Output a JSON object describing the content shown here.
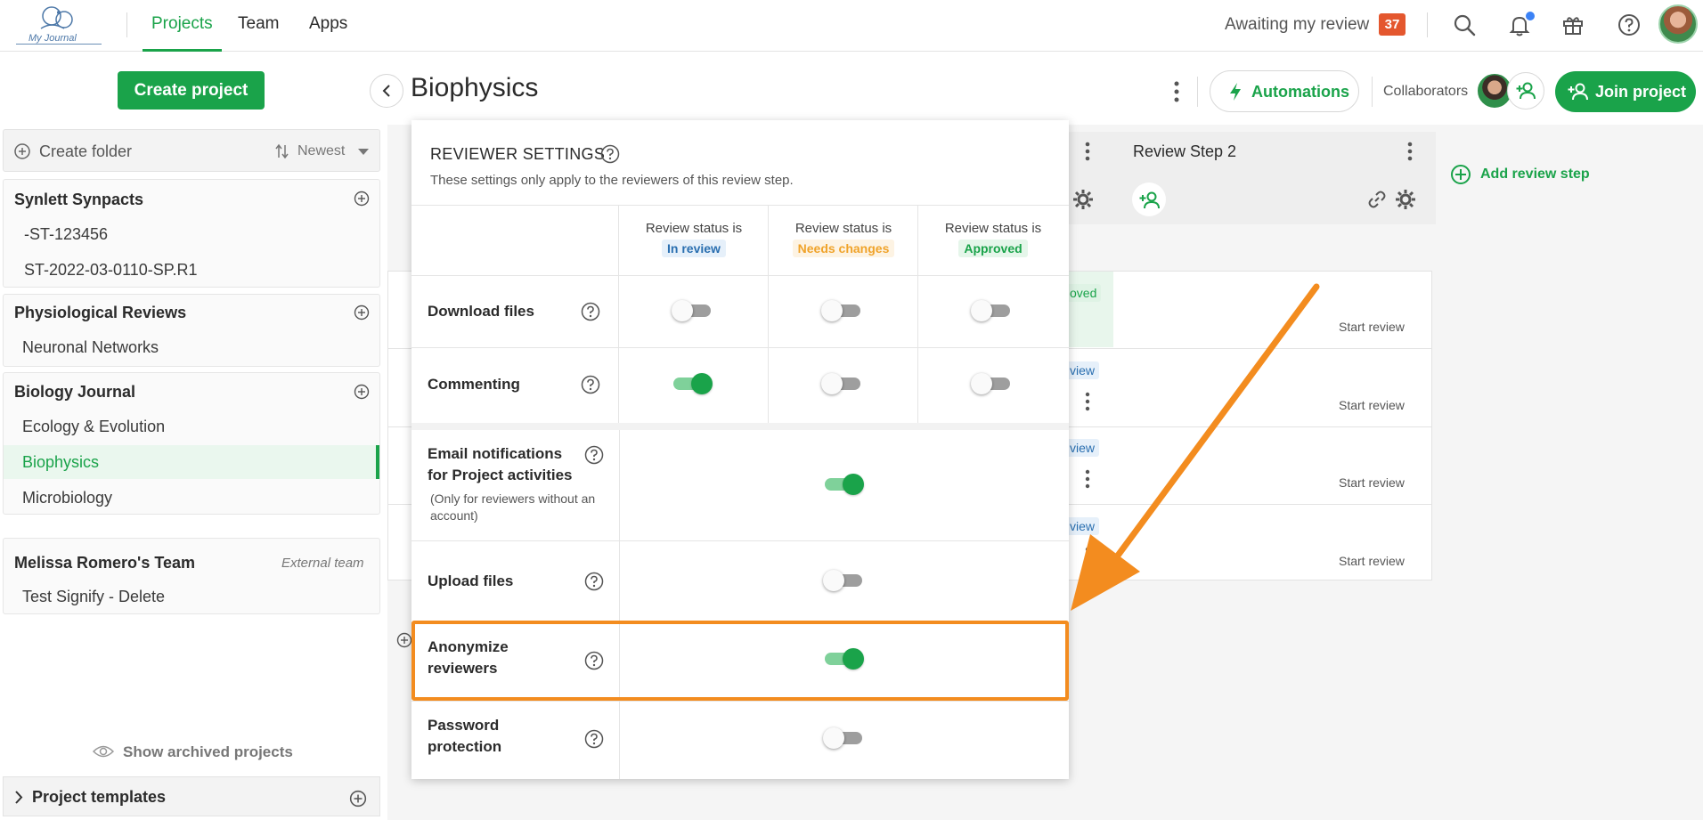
{
  "topbar": {
    "logo_text": "My Journal",
    "nav": [
      {
        "label": "Projects",
        "active": true
      },
      {
        "label": "Team",
        "active": false
      },
      {
        "label": "Apps",
        "active": false
      }
    ],
    "awaiting_label": "Awaiting my review",
    "awaiting_count": "37",
    "icons": [
      "search-icon",
      "bell-icon",
      "gift-icon",
      "help-icon"
    ]
  },
  "sidebar": {
    "create_project": "Create project",
    "create_folder": "Create folder",
    "sort": "Newest",
    "groups": [
      {
        "title": "Synlett Synpacts",
        "items": [
          "-ST-123456",
          "ST-2022-03-0110-SP.R1"
        ]
      },
      {
        "title": "Physiological Reviews",
        "items": [
          "Neuronal Networks"
        ]
      },
      {
        "title": "Biology Journal",
        "items": [
          "Ecology & Evolution",
          "Biophysics",
          "Microbiology"
        ],
        "active_item": "Biophysics"
      },
      {
        "title": "Melissa Romero's Team",
        "tag": "External team",
        "items": [
          "Test Signify - Delete"
        ]
      }
    ],
    "show_archived": "Show archived projects",
    "project_templates": "Project templates"
  },
  "main": {
    "title": "Biophysics",
    "automations": "Automations",
    "collaborators": "Collaborators",
    "join_project": "Join project",
    "review_step_2": "Review Step 2",
    "add_review_step": "Add review step",
    "rows": [
      {
        "status": "oved",
        "action": "Start review"
      },
      {
        "status": "view",
        "action": "Start review"
      },
      {
        "status": "view",
        "action": "Start review"
      },
      {
        "status": "view",
        "action": "Start review"
      }
    ]
  },
  "popup": {
    "title": "REVIEWER SETTINGS",
    "subtitle": "These settings only apply to the reviewers of this review step.",
    "column_prefix": "Review status is",
    "columns": [
      {
        "status": "In review",
        "color": "#2a6fb0",
        "bg": "#e6f0fa"
      },
      {
        "status": "Needs changes",
        "color": "#f0a32a",
        "bg": "#fdf3e3"
      },
      {
        "status": "Approved",
        "color": "#1aa34a",
        "bg": "#e5f6ea"
      }
    ],
    "per_status_rows": [
      {
        "label": "Download files",
        "values": [
          false,
          false,
          false
        ]
      },
      {
        "label": "Commenting",
        "values": [
          true,
          false,
          false
        ]
      }
    ],
    "global_rows": [
      {
        "label": "Email notifications for Project activities",
        "note": "(Only for reviewers without an account)",
        "value": true
      },
      {
        "label": "Upload files",
        "note": "",
        "value": false
      },
      {
        "label": "Anonymize reviewers",
        "note": "",
        "value": true
      },
      {
        "label": "Password protection",
        "note": "",
        "value": false
      }
    ]
  },
  "colors": {
    "brand": "#1aa34a",
    "highlight": "#f38c1f",
    "badge": "#e4572e"
  }
}
